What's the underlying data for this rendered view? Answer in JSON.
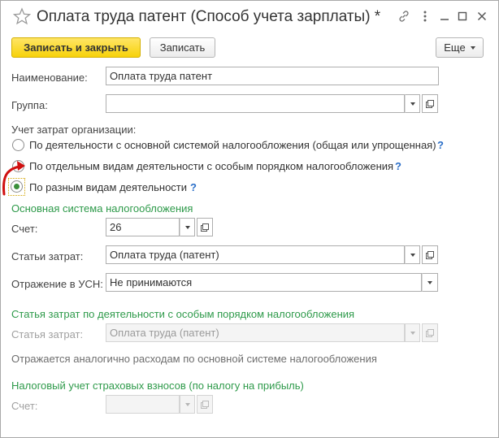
{
  "window": {
    "title": "Оплата труда патент (Способ учета зарплаты) *"
  },
  "toolbar": {
    "save_close_label": "Записать и закрыть",
    "save_label": "Записать",
    "more_label": "Еще"
  },
  "form": {
    "name_label": "Наименование:",
    "name_value": "Оплата труда патент",
    "group_label": "Группа:",
    "group_value": "",
    "cost_accounting_label": "Учет затрат организации:",
    "radio_options": [
      {
        "label": "По деятельности с основной системой налогообложения (общая или упрощенная)",
        "help": "?"
      },
      {
        "label": "По отдельным видам деятельности с особым порядком налогообложения",
        "help": "?"
      },
      {
        "label": "По разным видам деятельности",
        "help": "?"
      }
    ],
    "selected_option": 2
  },
  "main_tax": {
    "section_title": "Основная система налогообложения",
    "account_label": "Счет:",
    "account_value": "26",
    "cost_items_label": "Статьи затрат:",
    "cost_items_value": "Оплата труда (патент)",
    "usn_label": "Отражение в УСН:",
    "usn_value": "Не принимаются"
  },
  "special_tax": {
    "section_title": "Статья затрат по деятельности с особым порядком налогообложения",
    "cost_item_label": "Статья затрат:",
    "cost_item_value": "Оплата труда (патент)",
    "note": "Отражается аналогично расходам по основной системе налогообложения"
  },
  "insurance": {
    "section_title": "Налоговый учет страховых взносов (по налогу на прибыль)",
    "account_label": "Счет:",
    "account_value": ""
  },
  "colors": {
    "section_green": "#2e9a4a",
    "primary_button": "#f7d20a",
    "help_blue": "#2a6ec8",
    "annotation_red": "#d01010"
  }
}
